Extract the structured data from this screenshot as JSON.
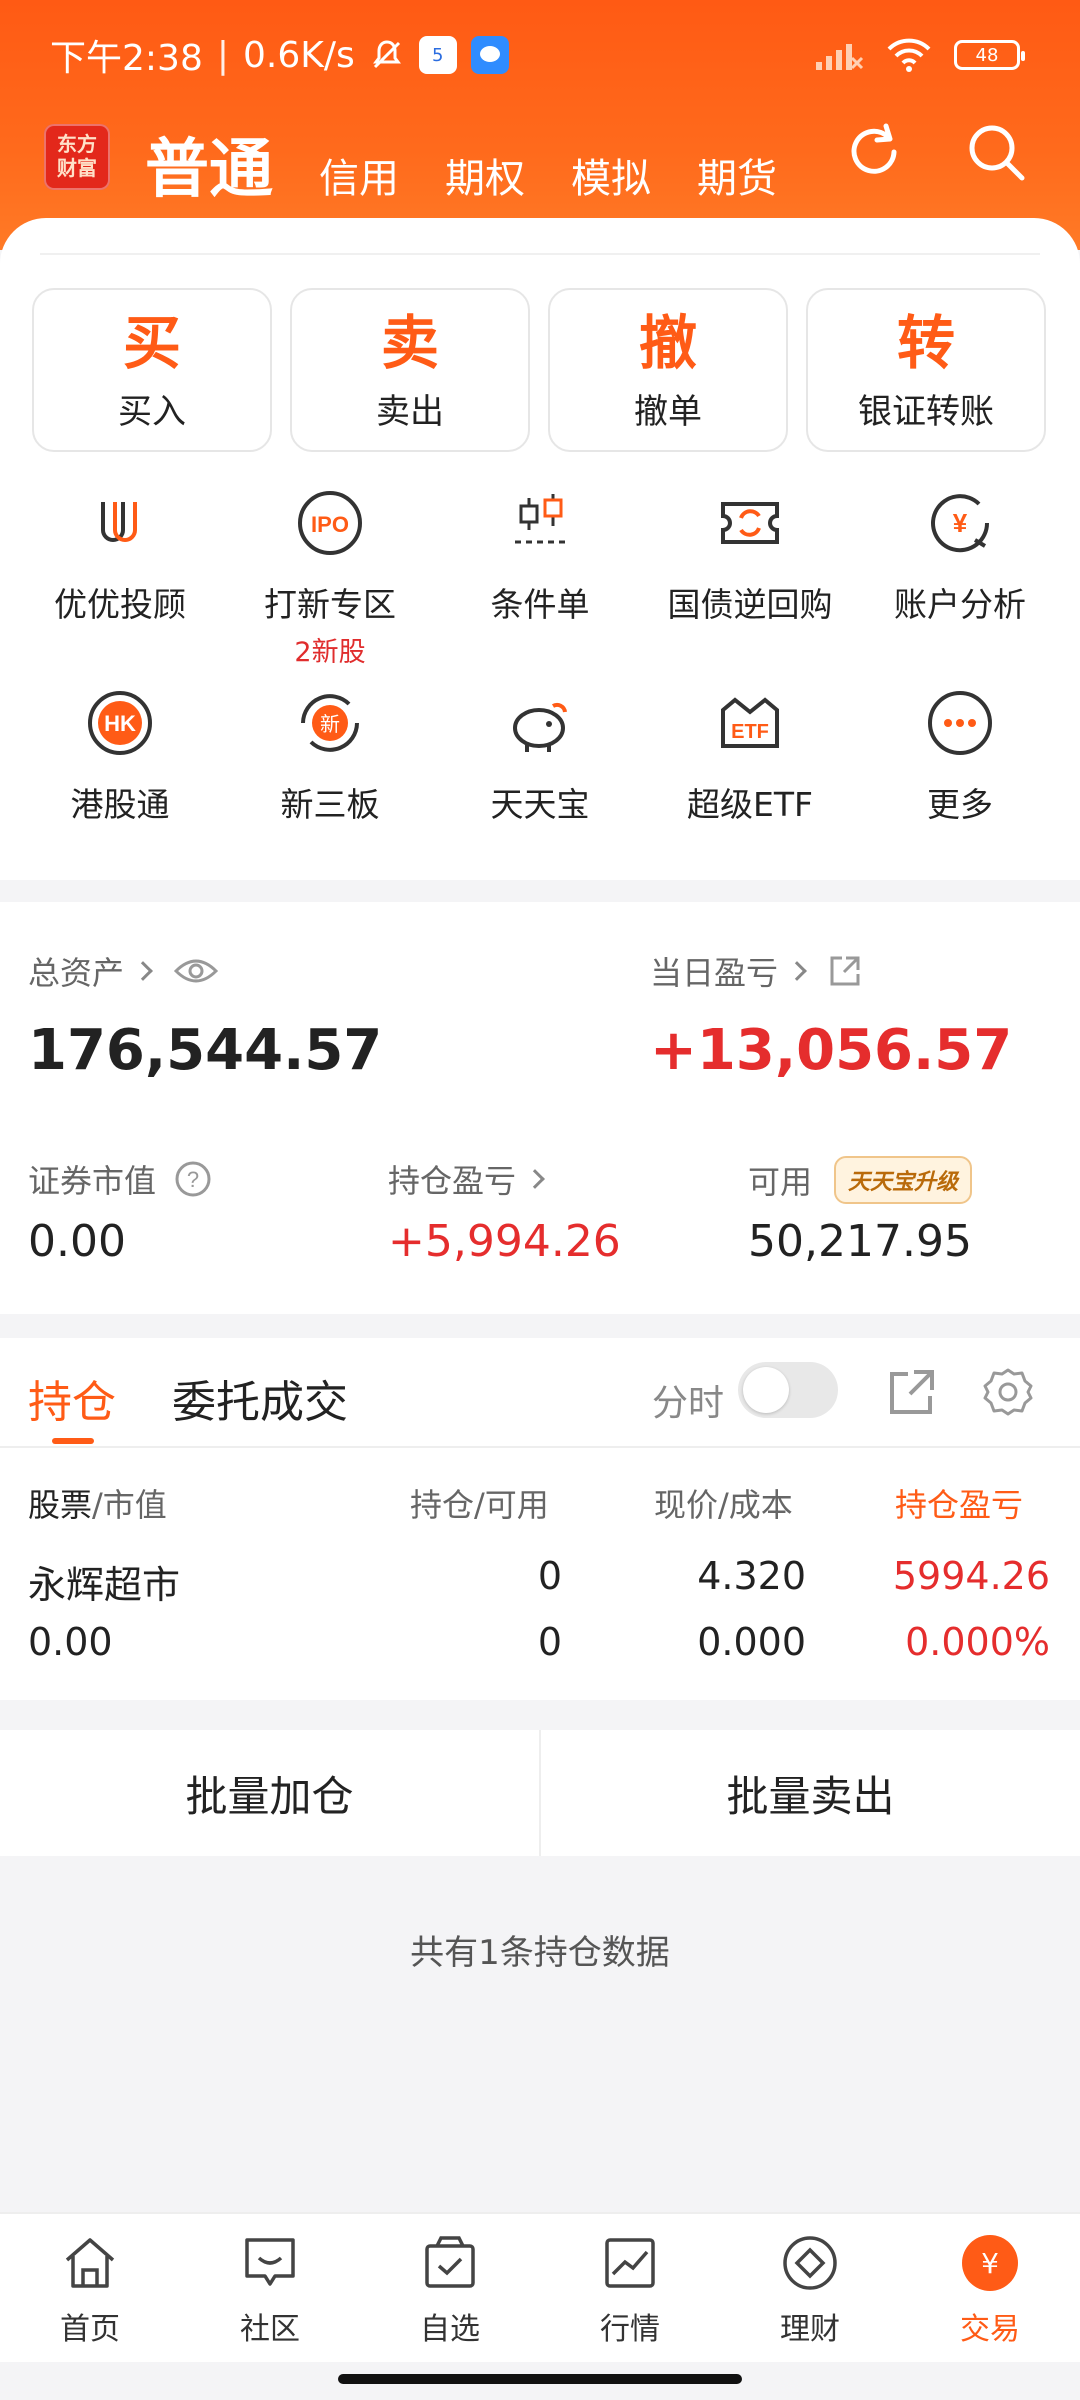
{
  "status_bar": {
    "time": "下午2:38",
    "separator": "|",
    "speed": "0.6K/s",
    "notif_badge": "5",
    "battery": "48"
  },
  "header": {
    "logo_text": "东方财富",
    "modes": [
      {
        "label": "普通",
        "active": true
      },
      {
        "label": "信用",
        "active": false
      },
      {
        "label": "期权",
        "active": false
      },
      {
        "label": "模拟",
        "active": false
      },
      {
        "label": "期货",
        "active": false
      }
    ],
    "accent": "#ff5b16"
  },
  "quick_actions": [
    {
      "big": "买",
      "small": "买入"
    },
    {
      "big": "卖",
      "small": "卖出"
    },
    {
      "big": "撤",
      "small": "撤单"
    },
    {
      "big": "转",
      "small": "银证转账"
    }
  ],
  "feature_grid": {
    "row1": [
      {
        "label": "优优投顾",
        "icon": "youyou-icon"
      },
      {
        "label": "打新专区",
        "sub": "2新股",
        "icon": "ipo-icon"
      },
      {
        "label": "条件单",
        "icon": "condition-order-icon"
      },
      {
        "label": "国债逆回购",
        "icon": "reverse-repo-icon"
      },
      {
        "label": "账户分析",
        "icon": "account-analysis-icon"
      }
    ],
    "row2": [
      {
        "label": "港股通",
        "icon": "hk-icon"
      },
      {
        "label": "新三板",
        "icon": "new-third-board-icon"
      },
      {
        "label": "天天宝",
        "icon": "piggy-bank-icon"
      },
      {
        "label": "超级ETF",
        "icon": "etf-icon"
      },
      {
        "label": "更多",
        "icon": "more-icon"
      }
    ]
  },
  "assets": {
    "total_label": "总资产",
    "total_value": "176,544.57",
    "daily_pnl_label": "当日盈亏",
    "daily_pnl_value": "+13,056.57",
    "market_value_label": "证券市值",
    "market_value": "0.00",
    "position_pnl_label": "持仓盈亏",
    "position_pnl": "+5,994.26",
    "available_label": "可用",
    "available_value": "50,217.95",
    "upgrade_badge": "天天宝升级"
  },
  "holdings": {
    "tab_positions": "持仓",
    "tab_orders": "委托成交",
    "timeshare_label": "分时",
    "columns": {
      "c1a": "股票",
      "c1b": "/市值",
      "c2": "持仓/可用",
      "c3": "现价/成本",
      "c4": "持仓盈亏"
    },
    "rows": [
      {
        "name": "永辉超市",
        "market_value": "0.00",
        "position": "0",
        "available": "0",
        "price": "4.320",
        "cost": "0.000",
        "pnl": "5994.26",
        "pnl_pct": "0.000%"
      }
    ]
  },
  "bulk_actions": {
    "add": "批量加仓",
    "sell": "批量卖出"
  },
  "footer_note": "共有1条持仓数据",
  "bottom_nav": [
    {
      "label": "首页",
      "icon": "home-icon",
      "active": false
    },
    {
      "label": "社区",
      "icon": "community-icon",
      "active": false
    },
    {
      "label": "自选",
      "icon": "watchlist-icon",
      "active": false
    },
    {
      "label": "行情",
      "icon": "market-icon",
      "active": false
    },
    {
      "label": "理财",
      "icon": "wealth-icon",
      "active": false
    },
    {
      "label": "交易",
      "icon": "trade-icon",
      "active": true
    }
  ]
}
